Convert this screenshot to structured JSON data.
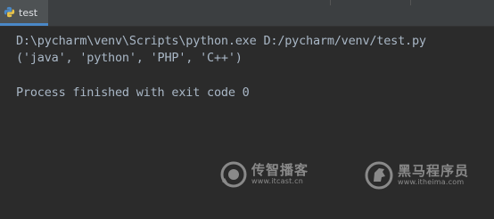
{
  "tab": {
    "label": "test",
    "icon": "python-icon"
  },
  "console": {
    "lines": {
      "command": "D:\\pycharm\\venv\\Scripts\\python.exe D:/pycharm/venv/test.py",
      "output": "('java', 'python', 'PHP', 'C++')",
      "exit": "Process finished with exit code 0"
    },
    "text_color": "#a9b7c6",
    "background": "#2b2b2b"
  },
  "watermarks": {
    "left": {
      "name": "传智播客",
      "url": "www.itcast.cn",
      "icon": "itcast-logo-icon"
    },
    "right": {
      "name": "黑马程序员",
      "url": "www.itheima.com",
      "icon": "horse-logo-icon"
    }
  },
  "colors": {
    "tab_underline": "#4a88c7",
    "tab_background": "#4e5254",
    "tabbar_background": "#3c3f41"
  }
}
